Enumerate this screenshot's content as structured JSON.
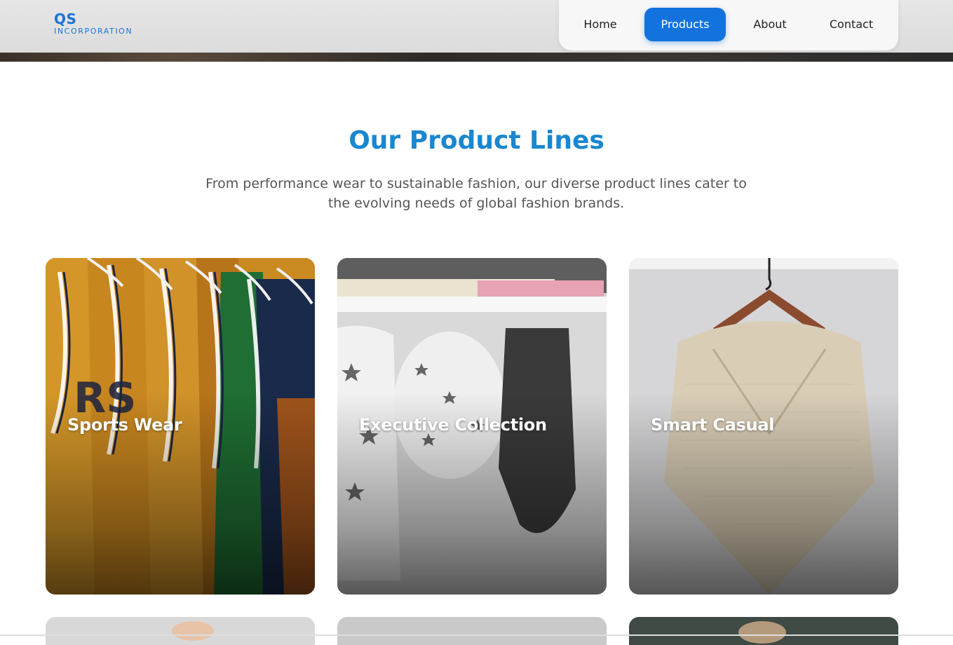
{
  "logo": {
    "main": "QS",
    "sub": "INCORPORATION"
  },
  "nav": {
    "items": [
      {
        "label": "Home",
        "active": false
      },
      {
        "label": "Products",
        "active": true
      },
      {
        "label": "About",
        "active": false
      },
      {
        "label": "Contact",
        "active": false
      }
    ]
  },
  "section": {
    "title": "Our Product Lines",
    "subtitle": "From performance wear to sustainable fashion, our diverse product lines cater to the evolving needs of global fashion brands."
  },
  "cards": [
    {
      "title": "Sports Wear"
    },
    {
      "title": "Executive Collection"
    },
    {
      "title": "Smart Casual"
    }
  ],
  "colors": {
    "accent": "#1273de",
    "title": "#1a87cf",
    "logo": "#1a73d9"
  }
}
